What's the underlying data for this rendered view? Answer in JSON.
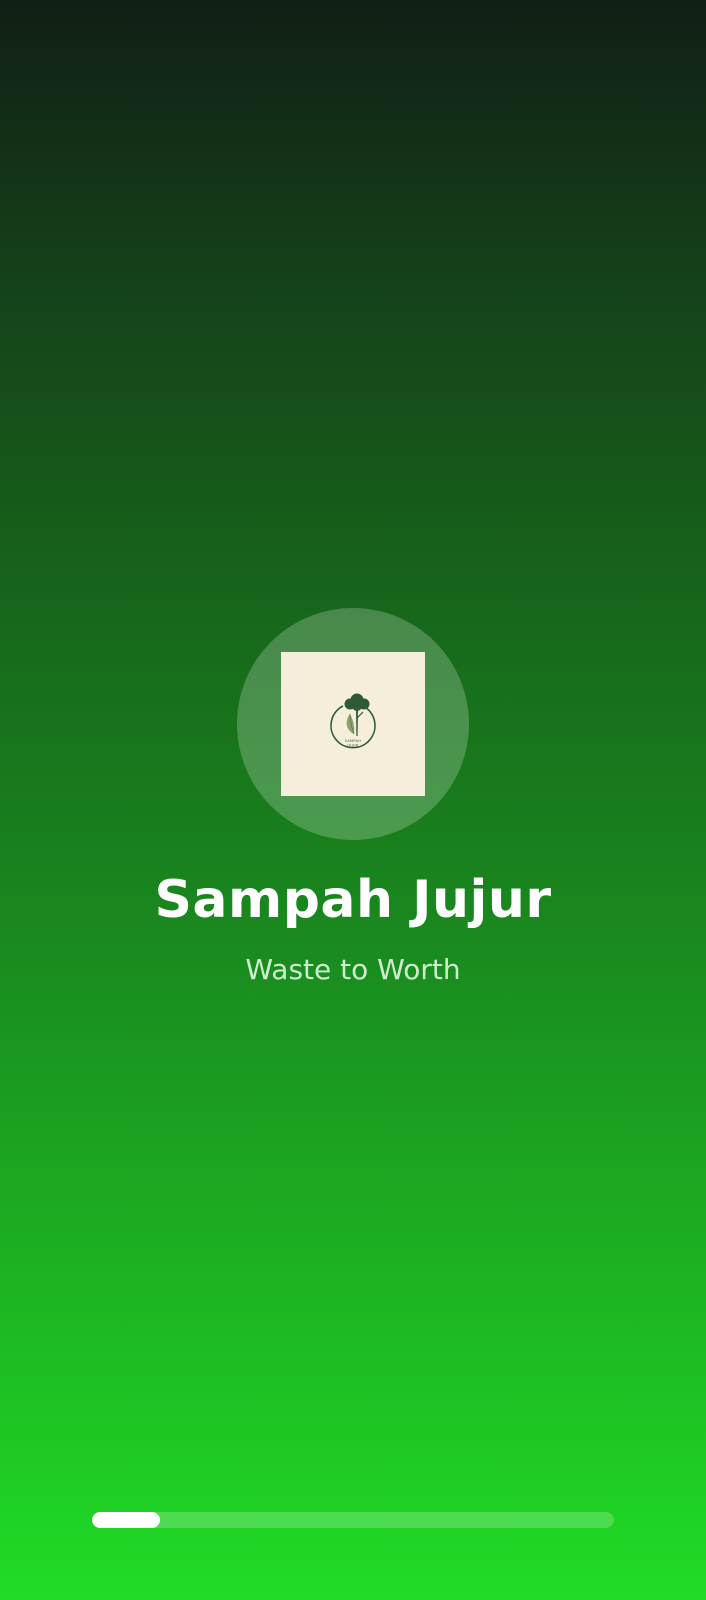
{
  "app": {
    "title": "Sampah Jujur",
    "tagline": "Waste to Worth",
    "logo_text": "SAMPAH JUJUR"
  },
  "loading": {
    "progress": 0.13
  },
  "colors": {
    "background_top": "#111f15",
    "background_bottom": "#20dc26",
    "logo_card": "#f5eedb",
    "logo_mark": "#2e5a36",
    "progress_fill": "#ffffff"
  },
  "icons": {
    "logo": "tree-leaf-logo-icon"
  }
}
